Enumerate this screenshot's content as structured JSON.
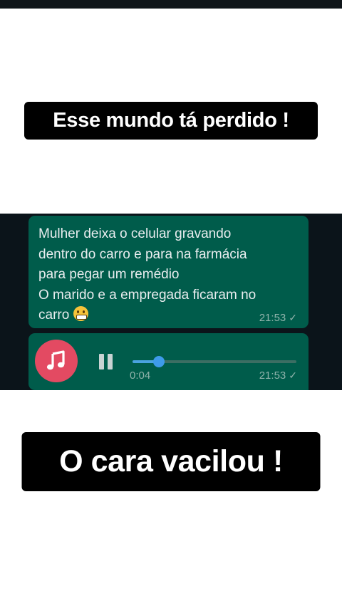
{
  "captions": {
    "top": "Esse mundo tá perdido !",
    "bottom": "O cara vacilou !"
  },
  "chat": {
    "messages": [
      {
        "type": "text",
        "text": "Mulher deixa o celular gravando\ndentro do carro e para na farmácia\npara pegar um remédio\nO marido e a empregada ficaram no\ncarro",
        "emoji": "grimacing-face-emoji",
        "time": "21:53",
        "status_icon": "check-icon"
      },
      {
        "type": "audio",
        "thumb_icon": "music-note-icon",
        "control_icon": "pause-icon",
        "progress": 0.16,
        "duration": "0:04",
        "time": "21:53",
        "status_icon": "check-icon"
      }
    ]
  },
  "colors": {
    "caption_bg": "#000000",
    "chat_bg": "#0b141a",
    "bubble_out": "#005c4b",
    "audio_thumb": "#e34a62",
    "progress_accent": "#3e9bea"
  }
}
